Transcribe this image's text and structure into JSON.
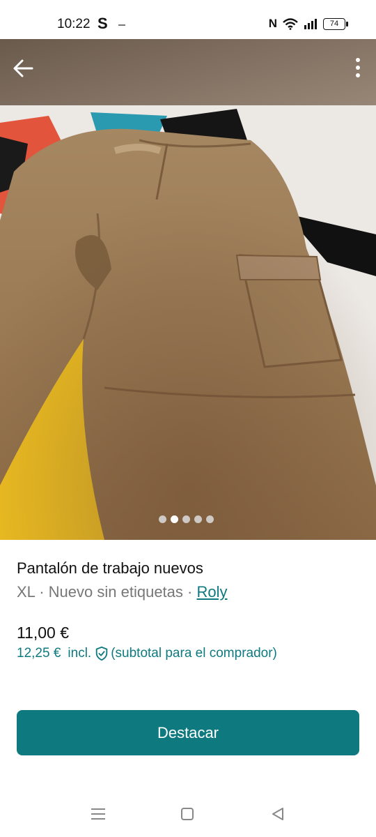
{
  "status_bar": {
    "time": "10:22",
    "s_glyph": "S",
    "nfc_glyph": "N",
    "battery": "74",
    "icons": [
      "nfc-icon",
      "wifi-icon",
      "signal-icon",
      "battery-icon"
    ]
  },
  "photo": {
    "slide_count": 5,
    "active_slide": 2,
    "subject": "khaki cargo trousers on a bed"
  },
  "listing": {
    "title": "Pantalón de trabajo nuevos",
    "size": "XL",
    "condition": "Nuevo sin etiquetas",
    "separator": "·",
    "brand": "Roly",
    "price": "11,00 €",
    "buyer_price": "12,25 €",
    "incl": "incl.",
    "buyer_note": "(subtotal para el comprador)"
  },
  "actions": {
    "cta_label": "Destacar"
  },
  "colors": {
    "accent": "#0e7a80",
    "muted_text": "#777777"
  }
}
